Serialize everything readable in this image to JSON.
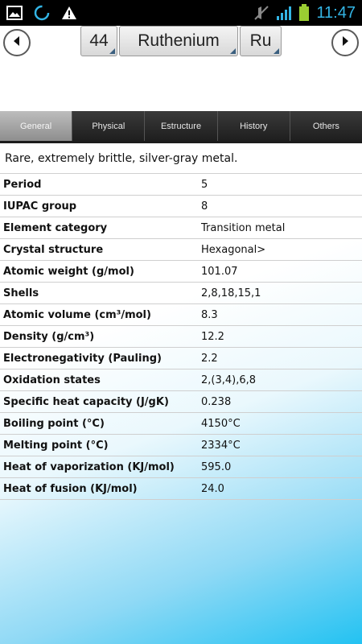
{
  "statusbar": {
    "time": "11:47",
    "icons": [
      "image-icon",
      "sync-icon",
      "warning-icon",
      "mute-icon",
      "signal-icon",
      "battery-icon"
    ]
  },
  "header": {
    "atomic_number": "44",
    "element_name": "Ruthenium",
    "symbol": "Ru",
    "prev_icon": "chevron-left-icon",
    "next_icon": "chevron-right-icon"
  },
  "tabs": [
    {
      "label": "General",
      "active": true
    },
    {
      "label": "Physical",
      "active": false
    },
    {
      "label": "Estructure",
      "active": false
    },
    {
      "label": "History",
      "active": false
    },
    {
      "label": "Others",
      "active": false
    }
  ],
  "description": "Rare, extremely brittle, silver-gray metal.",
  "properties": [
    {
      "key": "Period",
      "value": "5"
    },
    {
      "key": "IUPAC group",
      "value": "8"
    },
    {
      "key": "Element category",
      "value": "Transition metal"
    },
    {
      "key": "Crystal structure",
      "value": "Hexagonal>"
    },
    {
      "key": "Atomic weight (g/mol)",
      "value": "101.07"
    },
    {
      "key": "Shells",
      "value": "2,8,18,15,1"
    },
    {
      "key": "Atomic volume (cm³/mol)",
      "value": "8.3"
    },
    {
      "key": "Density (g/cm³)",
      "value": "12.2"
    },
    {
      "key": "Electronegativity (Pauling)",
      "value": "2.2"
    },
    {
      "key": "Oxidation states",
      "value": "2,(3,4),6,8"
    },
    {
      "key": "Specific heat capacity (J/gK)",
      "value": "0.238"
    },
    {
      "key": "Boiling point (°C)",
      "value": "4150°C"
    },
    {
      "key": "Melting point (°C)",
      "value": "2334°C"
    },
    {
      "key": "Heat of vaporization (KJ/mol)",
      "value": "595.0"
    },
    {
      "key": "Heat of fusion (KJ/mol)",
      "value": "24.0"
    }
  ],
  "colors": {
    "accent": "#33b5e5",
    "tab_bar": "#2a2a2a",
    "background_gradient_end": "#23c2f2"
  }
}
